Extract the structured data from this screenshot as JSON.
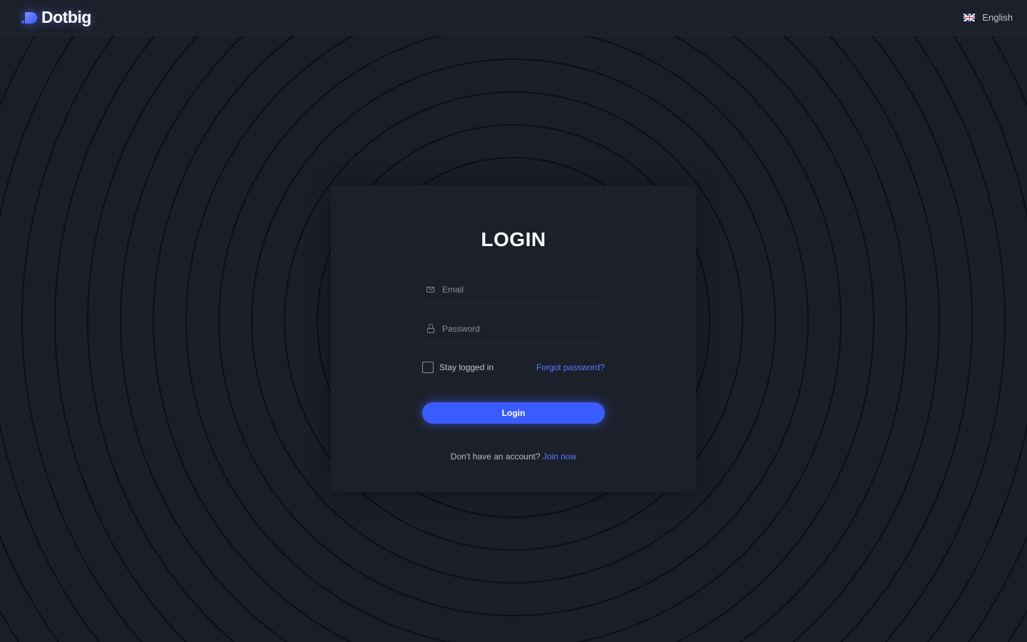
{
  "header": {
    "brand": "Dotbig",
    "language": "English"
  },
  "login": {
    "title": "LOGIN",
    "email_placeholder": "Email",
    "password_placeholder": "Password",
    "stay_logged_in": "Stay logged in",
    "forgot_password": "Forgot password?",
    "submit_label": "Login",
    "no_account_text": "Don't have an account?",
    "join_now": "Join now"
  },
  "icons": {
    "brand": "dotbig-logo-icon",
    "language": "uk-flag-icon",
    "email": "mail-icon",
    "password": "lock-icon"
  },
  "colors": {
    "accent": "#3a5cff",
    "link": "#5a7cff",
    "background": "#1a1d27",
    "card": "#1c202b"
  }
}
